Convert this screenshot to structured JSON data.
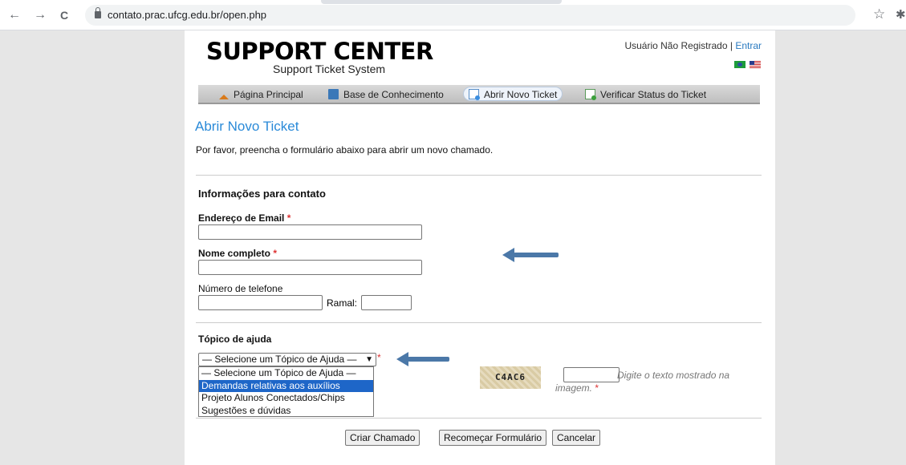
{
  "browser": {
    "url": "contato.prac.ufcg.edu.br/open.php",
    "back_icon": "←",
    "forward_icon": "→",
    "reload_icon": "C",
    "star_icon": "☆",
    "extension_icon": "✱"
  },
  "header": {
    "logo_main": "SUPPORT CENTER",
    "logo_sub": "Support Ticket System",
    "user_status": "Usuário Não Registrado",
    "separator": " | ",
    "login_link": "Entrar"
  },
  "nav": {
    "items": [
      {
        "label": "Página Principal",
        "icon": "home-icon"
      },
      {
        "label": "Base de Conhecimento",
        "icon": "book-icon"
      },
      {
        "label": "Abrir Novo Ticket",
        "icon": "new-ticket-icon",
        "active": true
      },
      {
        "label": "Verificar Status do Ticket",
        "icon": "status-icon"
      }
    ]
  },
  "main": {
    "title": "Abrir Novo Ticket",
    "intro": "Por favor, preencha o formulário abaixo para abrir um novo chamado.",
    "contact_section": "Informações para contato",
    "email_label": "Endereço de Email",
    "name_label": "Nome completo",
    "phone_label": "Número de telefone",
    "ramal_label": "Ramal:",
    "required_mark": "*",
    "topic_section": "Tópico de ajuda",
    "topic_selected": "— Selecione um Tópico de Ajuda —",
    "topic_options": [
      "— Selecione um Tópico de Ajuda —",
      "Demandas relativas aos auxílios",
      "Projeto Alunos Conectados/Chips",
      "Sugestões e dúvidas"
    ],
    "captcha_text": "C4AC6",
    "captcha_hint": "Digite o texto mostrado na imagem.",
    "buttons": {
      "submit": "Criar Chamado",
      "reset": "Recomeçar Formulário",
      "cancel": "Cancelar"
    }
  },
  "colors": {
    "accent": "#2a8ad8",
    "arrow": "#4b78a8",
    "dropdown_highlight": "#1e66c8"
  }
}
